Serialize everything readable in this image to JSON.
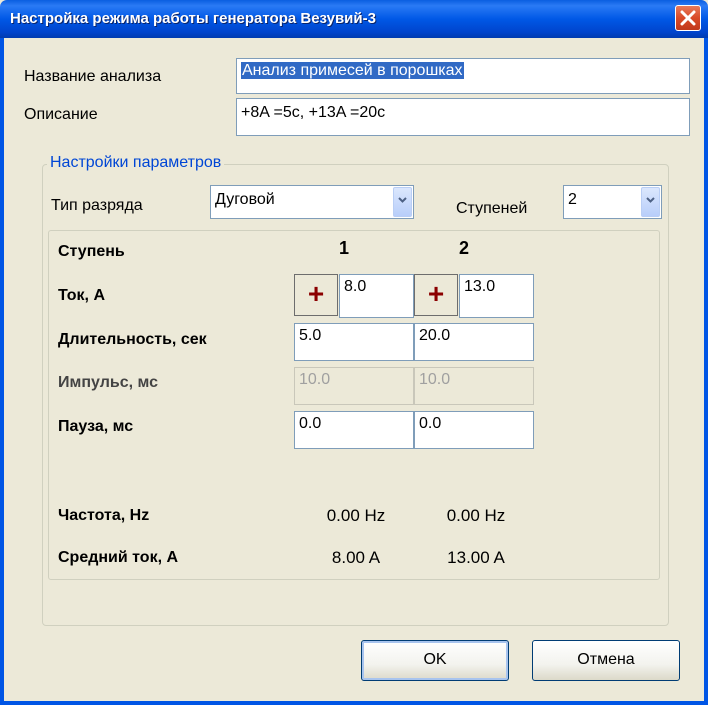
{
  "window": {
    "title": "Настройка режима работы генератора Везувий-3"
  },
  "analysis": {
    "name_label": "Название анализа",
    "name_value": "Анализ примесей в порошках",
    "desc_label": "Описание",
    "desc_value": "+8A =5c, +13A =20c"
  },
  "params": {
    "group_title": "Настройки параметров",
    "discharge_label": "Тип разряда",
    "discharge_value": "Дуговой",
    "steps_label": "Ступеней",
    "steps_value": "2"
  },
  "table": {
    "step_label": "Ступень",
    "step_1": "1",
    "step_2": "2",
    "current_label": "Ток, А",
    "current_sign": "+",
    "current_1": "8.0",
    "current_2": "13.0",
    "duration_label": "Длительность, сек",
    "duration_1": "5.0",
    "duration_2": "20.0",
    "impulse_label": "Импульс, мс",
    "impulse_1": "10.0",
    "impulse_2": "10.0",
    "pause_label": "Пауза, мс",
    "pause_1": "0.0",
    "pause_2": "0.0",
    "freq_label": "Частота, Hz",
    "freq_1": "0.00 Hz",
    "freq_2": "0.00 Hz",
    "avg_label": "Средний ток, А",
    "avg_1": "8.00 A",
    "avg_2": "13.00 A"
  },
  "buttons": {
    "ok": "OK",
    "cancel": "Отмена"
  }
}
